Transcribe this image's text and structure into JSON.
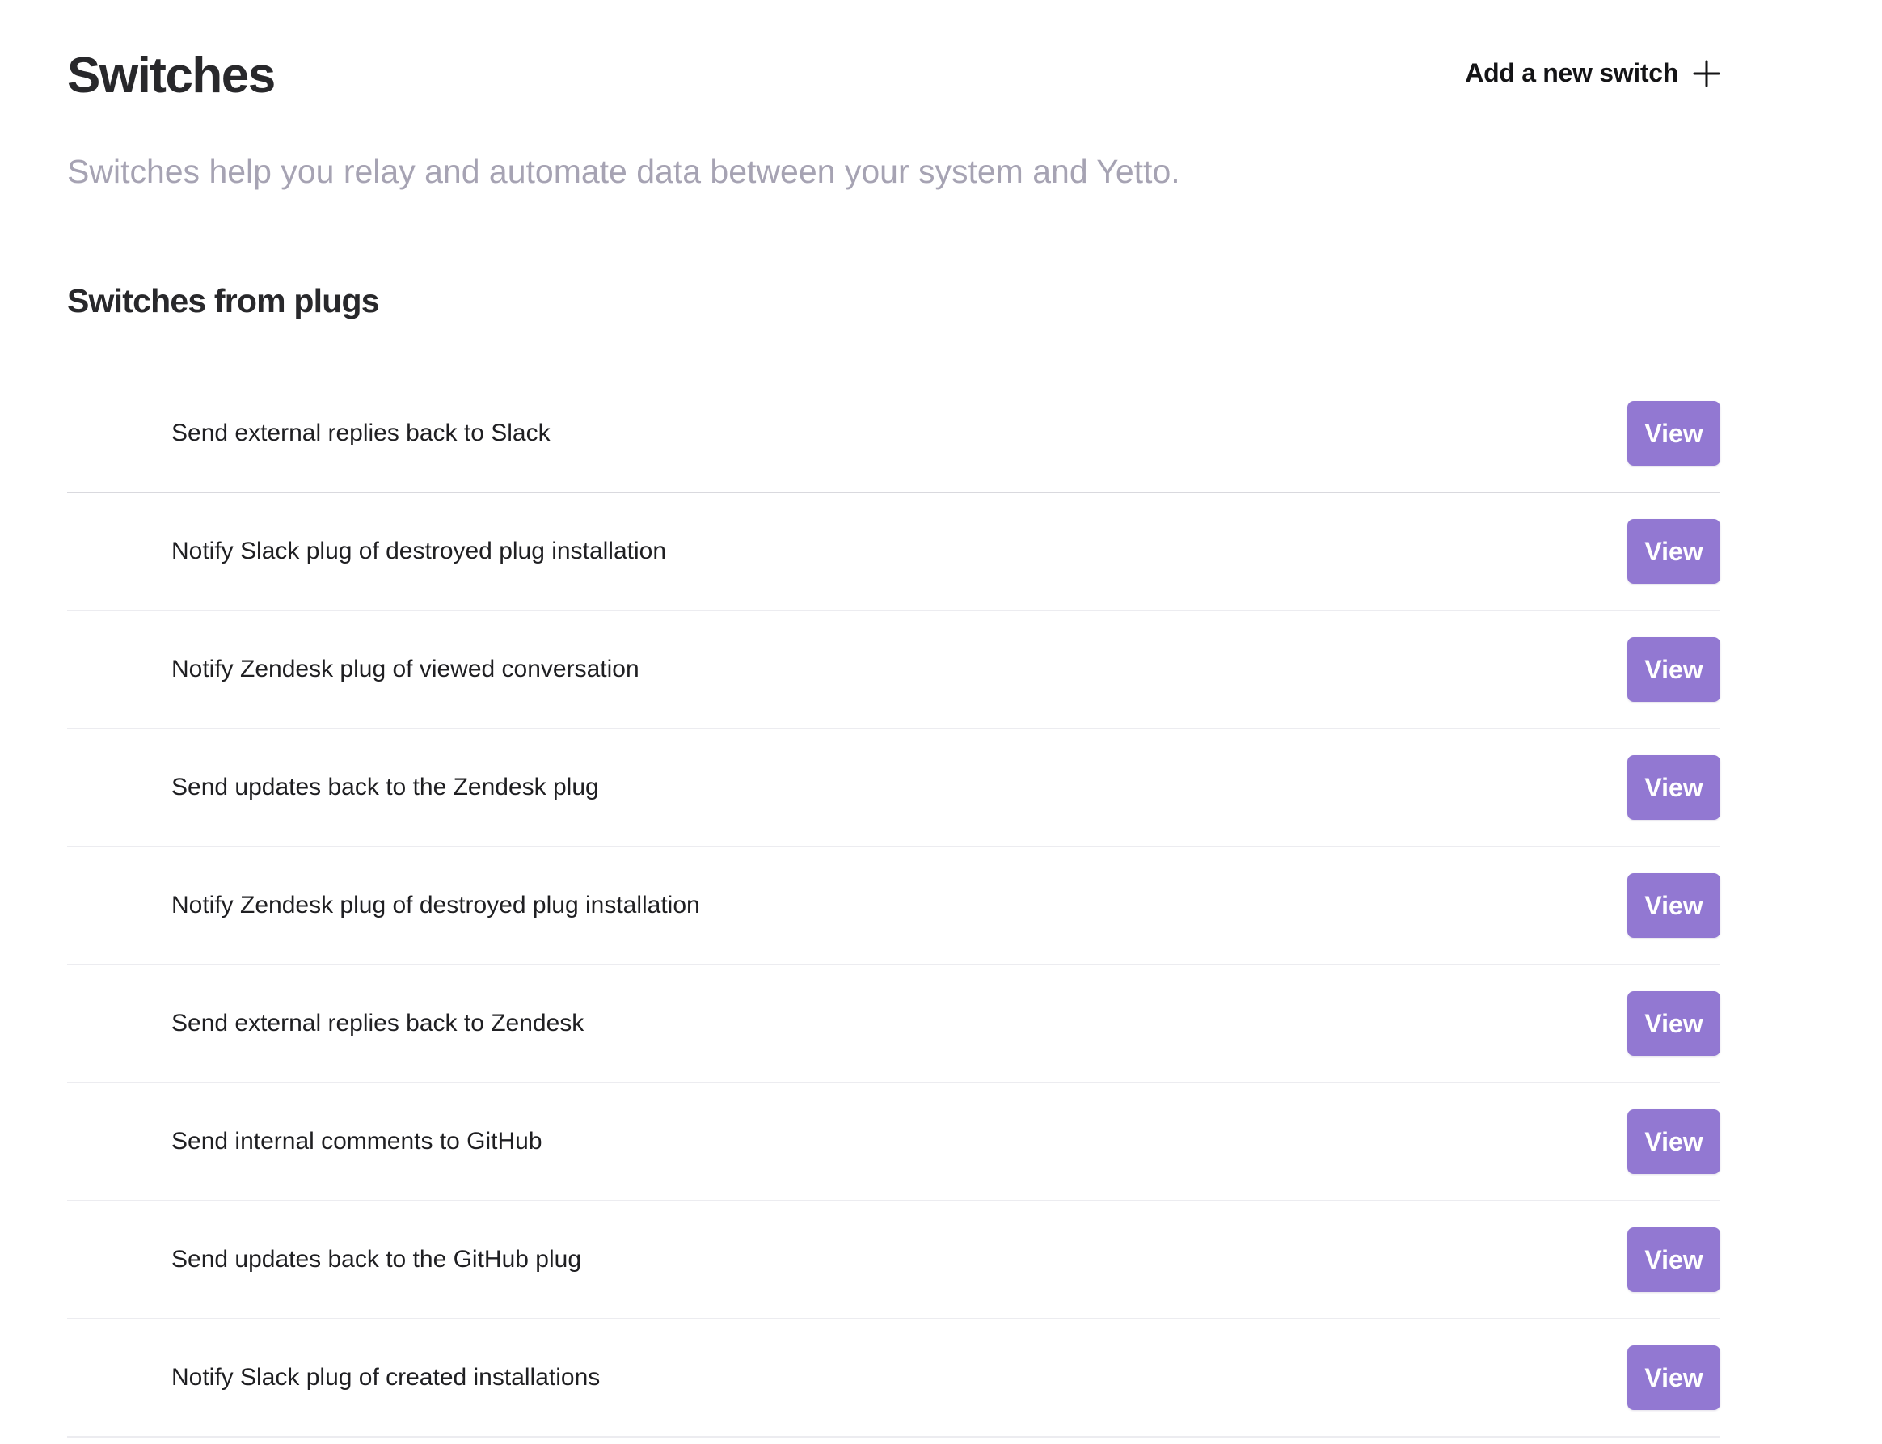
{
  "header": {
    "title": "Switches",
    "add_button_label": "Add a new switch"
  },
  "subtitle": "Switches help you relay and automate data between your system and Yetto.",
  "section": {
    "title": "Switches from plugs"
  },
  "switches": [
    {
      "label": "Send external replies back to Slack",
      "action": "View"
    },
    {
      "label": "Notify Slack plug of destroyed plug installation",
      "action": "View"
    },
    {
      "label": "Notify Zendesk plug of viewed conversation",
      "action": "View"
    },
    {
      "label": "Send updates back to the Zendesk plug",
      "action": "View"
    },
    {
      "label": "Notify Zendesk plug of destroyed plug installation",
      "action": "View"
    },
    {
      "label": "Send external replies back to Zendesk",
      "action": "View"
    },
    {
      "label": "Send internal comments to GitHub",
      "action": "View"
    },
    {
      "label": "Send updates back to the GitHub plug",
      "action": "View"
    },
    {
      "label": "Notify Slack plug of created installations",
      "action": "View"
    }
  ],
  "icons": {
    "add": "plus-icon"
  },
  "colors": {
    "accent": "#9278d2",
    "subtitle": "#a6a3b3",
    "divider": "#ececf0"
  }
}
